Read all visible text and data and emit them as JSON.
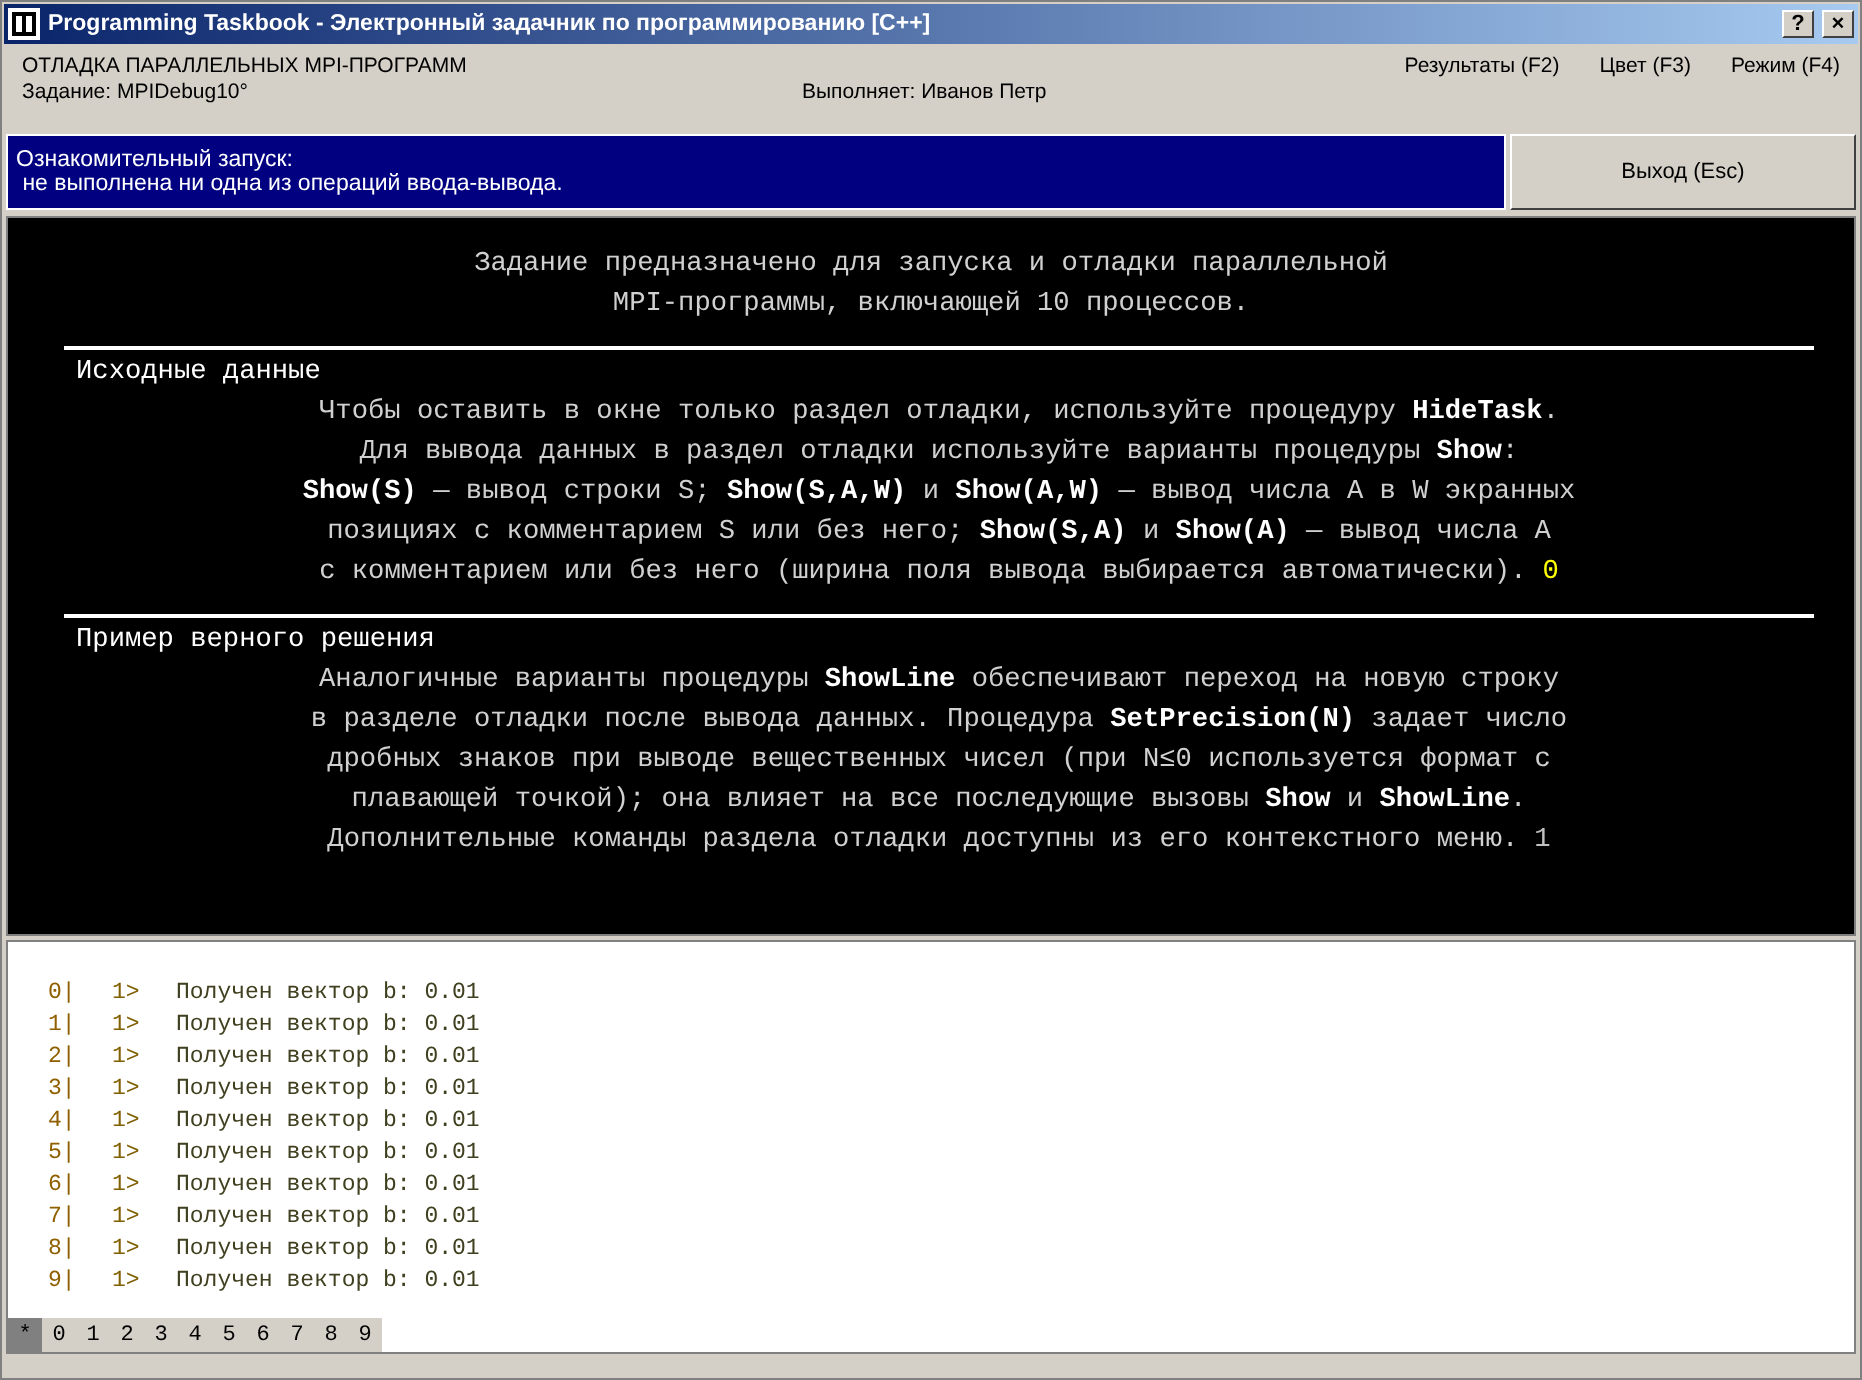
{
  "window": {
    "title": "Programming Taskbook - Электронный задачник по программированию [C++]",
    "buttons": [
      "?",
      "×"
    ]
  },
  "header": {
    "topic": "ОТЛАДКА ПАРАЛЛЕЛЬНЫХ MPI-ПРОГРАММ",
    "task": "Задание: MPIDebug10°",
    "student": "Выполняет: Иванов Петр",
    "menu": [
      "Результаты (F2)",
      "Цвет (F3)",
      "Режим (F4)"
    ]
  },
  "status": {
    "lines": [
      "Ознакомительный запуск:",
      " не выполнена ни одна из операций ввода-вывода."
    ],
    "exit_button": "Выход (Esc)"
  },
  "task_text": {
    "intro": [
      "Задание предназначено для запуска и отладки параллельной",
      "MPI-программы, включающей 10 процессов."
    ],
    "sections": [
      {
        "title": "Исходные данные",
        "mark": "0",
        "color": "#ffff00",
        "lines": [
          "Чтобы оставить в окне только раздел отладки, используйте процедуру **HideTask**.",
          "Для вывода данных в раздел отладки используйте варианты процедуры **Show**:",
          "**Show(S)** — вывод строки S; **Show(S,A,W)** и **Show(A,W)** — вывод числа A в W экранных",
          "позициях с комментарием S или без него; **Show(S,A)** и **Show(A)** — вывод числа A",
          "с комментарием или без него (ширина поля вывода выбирается автоматически)."
        ]
      },
      {
        "title": "Пример верного решения",
        "mark": "1",
        "color": "#c0c0c0",
        "lines": [
          "Аналогичные варианты процедуры **ShowLine** обеспечивают переход на новую строку",
          "в разделе отладки после вывода данных. Процедура **SetPrecision(N)** задает число",
          "дробных знаков при выводе вещественных чисел (при N≤0 используется формат с",
          "плавающей точкой); она влияет на все последующие вызовы **Show** и **ShowLine**.",
          "Дополнительные команды раздела отладки доступны из его контекстного меню."
        ]
      }
    ]
  },
  "debug": {
    "rows": [
      {
        "process": "0|",
        "line": "1>",
        "text": "Получен вектор b: 0.01"
      },
      {
        "process": "1|",
        "line": "1>",
        "text": "Получен вектор b: 0.01"
      },
      {
        "process": "2|",
        "line": "1>",
        "text": "Получен вектор b: 0.01"
      },
      {
        "process": "3|",
        "line": "1>",
        "text": "Получен вектор b: 0.01"
      },
      {
        "process": "4|",
        "line": "1>",
        "text": "Получен вектор b: 0.01"
      },
      {
        "process": "5|",
        "line": "1>",
        "text": "Получен вектор b: 0.01"
      },
      {
        "process": "6|",
        "line": "1>",
        "text": "Получен вектор b: 0.01"
      },
      {
        "process": "7|",
        "line": "1>",
        "text": "Получен вектор b: 0.01"
      },
      {
        "process": "8|",
        "line": "1>",
        "text": "Получен вектор b: 0.01"
      },
      {
        "process": "9|",
        "line": "1>",
        "text": "Получен вектор b: 0.01"
      }
    ],
    "tabs": [
      {
        "label": "*",
        "selected": true
      },
      {
        "label": "0",
        "selected": false
      },
      {
        "label": "1",
        "selected": false
      },
      {
        "label": "2",
        "selected": false
      },
      {
        "label": "3",
        "selected": false
      },
      {
        "label": "4",
        "selected": false
      },
      {
        "label": "5",
        "selected": false
      },
      {
        "label": "6",
        "selected": false
      },
      {
        "label": "7",
        "selected": false
      },
      {
        "label": "8",
        "selected": false
      },
      {
        "label": "9",
        "selected": false
      }
    ]
  }
}
